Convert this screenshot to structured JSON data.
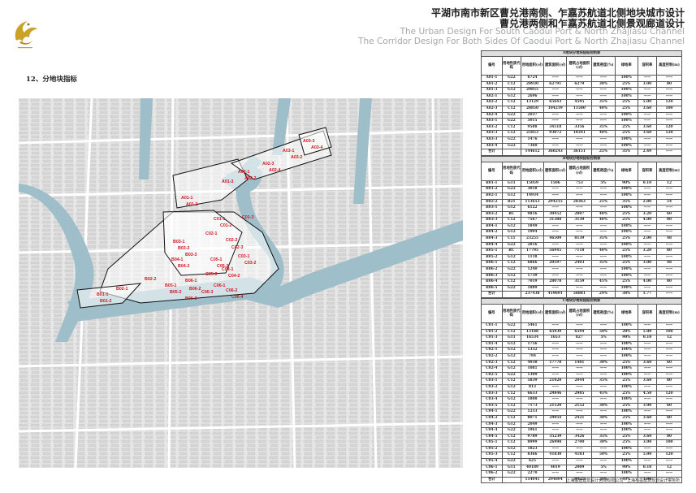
{
  "header": {
    "title_cn_1": "平湖市南市新区曹兑港南侧、乍嘉苏航道北侧地块城市设计",
    "title_cn_2": "曹兑港两侧和乍嘉苏航道北侧景观廊道设计",
    "title_en_1": "The Urban Design For South Caodui Port & North Zhajiasu Channel",
    "title_en_2": "The Corridor Design For Both Sides Of Caodui Port & North Zhajiasu Channel",
    "logo_icon": "phoenix-logo-icon"
  },
  "section": {
    "label": "12、分地块指标"
  },
  "map": {
    "labels": [
      "A03-3",
      "A03-4",
      "A03-1",
      "A03-2",
      "A02-3",
      "A02-4",
      "A02-1",
      "A02-2",
      "A01-3",
      "A01-1",
      "A01-2",
      "C01-1",
      "C01-2",
      "C01-3",
      "C02-1",
      "C02-2",
      "C02-3",
      "C03-1",
      "C03-2",
      "C04-1",
      "C04-2",
      "C05-1",
      "C05-2",
      "C05-3",
      "C06-1",
      "C06-2",
      "C06-3",
      "C06-4",
      "B01-1",
      "B01-2",
      "B02-1",
      "B02-2",
      "B03-1",
      "B03-2",
      "B03-3",
      "B04-1",
      "B04-2",
      "B05-1",
      "B05-2",
      "B06-1",
      "B06-2",
      "B06-3"
    ]
  },
  "tables": [
    {
      "caption": "A地块分地块指标控制表",
      "headers": [
        "编号",
        "用地性质代码",
        "用地面积(㎡)",
        "建筑面积(㎡)",
        "建筑占地面积(㎡)",
        "建筑密度(%)",
        "绿地率",
        "容积率",
        "高度控制(m)"
      ],
      "rows": [
        [
          "A01-1",
          "G22",
          "6724",
          "——",
          "——",
          "——",
          "100%",
          "——",
          "——"
        ],
        [
          "A01-2",
          "C12",
          "20930",
          "62791",
          "6279",
          "30%",
          "25%",
          "3.00",
          "80"
        ],
        [
          "A01-3",
          "G12",
          "20855",
          "——",
          "——",
          "——",
          "100%",
          "——",
          "——"
        ],
        [
          "A02-1",
          "G12",
          "2696",
          "——",
          "——",
          "——",
          "100%",
          "——",
          "——"
        ],
        [
          "A02-2",
          "C12",
          "13129",
          "65643",
          "4595",
          "35%",
          "25%",
          "5.00",
          "120"
        ],
        [
          "A02-3",
          "C12",
          "28850",
          "104219",
          "11580",
          "40%",
          "25%",
          "3.60",
          "100"
        ],
        [
          "A02-4",
          "G22",
          "2037",
          "——",
          "——",
          "——",
          "100%",
          "——",
          "——"
        ],
        [
          "A03-1",
          "G22",
          "5015",
          "——",
          "——",
          "——",
          "100%",
          "——",
          "——"
        ],
        [
          "A03-2",
          "C12",
          "9588",
          "34518",
          "3356",
          "35%",
          "25%",
          "3.60",
          "120"
        ],
        [
          "A03-3",
          "C12",
          "25853",
          "93072",
          "10341",
          "40%",
          "25%",
          "3.60",
          "120"
        ],
        [
          "A03-3",
          "G22",
          "1476",
          "——",
          "——",
          "——",
          "100%",
          "——",
          "——"
        ],
        [
          "A03-4",
          "G22",
          "7360",
          "——",
          "——",
          "——",
          "100%",
          "——",
          "——"
        ]
      ],
      "total": [
        "合计",
        "",
        "144612",
        "360243",
        "36151",
        "25%",
        "35%",
        "2.49",
        "——"
      ]
    },
    {
      "caption": "B地块分地块指标控制表",
      "headers": [
        "编号",
        "用地性质代码",
        "用地面积(㎡)",
        "建筑面积(㎡)",
        "建筑占地面积(㎡)",
        "建筑密度(%)",
        "绿地率",
        "容积率",
        "高度控制(m)"
      ],
      "rows": [
        [
          "B01-1",
          "G11",
          "15059",
          "1506",
          "753",
          "5%",
          "90%",
          "0.10",
          "12"
        ],
        [
          "B01-2",
          "G22",
          "3018",
          "——",
          "——",
          "——",
          "100%",
          "——",
          "——"
        ],
        [
          "B02-1",
          "G12",
          "14934",
          "——",
          "——",
          "——",
          "100%",
          "——",
          "——"
        ],
        [
          "B02-2",
          "R21",
          "113653",
          "294215",
          "28363",
          "25%",
          "35%",
          "2.80",
          "54"
        ],
        [
          "B03-1",
          "G12",
          "6122",
          "——",
          "——",
          "——",
          "100%",
          "——",
          "——"
        ],
        [
          "B03-2",
          "RC",
          "9816",
          "30452",
          "2807",
          "40%",
          "25%",
          "3.20",
          "60"
        ],
        [
          "B03-3",
          "C12",
          "7567",
          "31388",
          "3139",
          "40%",
          "25%",
          "4.00",
          "80"
        ],
        [
          "B04-1",
          "G12",
          "1849",
          "——",
          "——",
          "——",
          "100%",
          "——",
          "——"
        ],
        [
          "B04-2",
          "G12",
          "1904",
          "——",
          "——",
          "——",
          "100%",
          "——",
          "——"
        ],
        [
          "B04-3",
          "C11",
          "23255",
          "46509",
          "8139",
          "35%",
          "25%",
          "2.00",
          "48"
        ],
        [
          "B04-4",
          "G22",
          "2816",
          "——",
          "——",
          "——",
          "100%",
          "——",
          "——"
        ],
        [
          "B05-1",
          "RC",
          "17795",
          "56945",
          "7118",
          "40%",
          "25%",
          "3.20",
          "80"
        ],
        [
          "B05-2",
          "G12",
          "1118",
          "——",
          "——",
          "——",
          "100%",
          "——",
          "——"
        ],
        [
          "B06-1",
          "C12",
          "6866",
          "20597",
          "2403",
          "35%",
          "25%",
          "3.00",
          "48"
        ],
        [
          "B06-2",
          "G22",
          "1240",
          "——",
          "——",
          "——",
          "100%",
          "——",
          "——"
        ],
        [
          "B06-3",
          "G12",
          "1739",
          "——",
          "——",
          "——",
          "100%",
          "——",
          "——"
        ],
        [
          "B06-4",
          "C12",
          "7019",
          "28078",
          "3159",
          "45%",
          "25%",
          "4.00",
          "80"
        ],
        [
          "B06-5",
          "G22",
          "1889",
          "——",
          "——",
          "——",
          "100%",
          "——",
          "——"
        ]
      ],
      "total": [
        "合计",
        "",
        "237438",
        "419691",
        "56881",
        "24%",
        "38%",
        "1.77",
        "——"
      ]
    },
    {
      "caption": "C地块分地块指标控制表",
      "headers": [
        "编号",
        "用地性质代码",
        "用地面积(㎡)",
        "建筑面积(㎡)",
        "建筑占地面积(㎡)",
        "建筑密度(%)",
        "绿地率",
        "容积率",
        "高度控制(m)"
      ],
      "rows": [
        [
          "C01-1",
          "G22",
          "5461",
          "——",
          "——",
          "——",
          "100%",
          "——",
          "——"
        ],
        [
          "C01-2",
          "C12",
          "13188",
          "65939",
          "6594",
          "50%",
          "20%",
          "5.00",
          "100"
        ],
        [
          "C01-3",
          "G11",
          "16534",
          "1653",
          "827",
          "5%",
          "90%",
          "0.10",
          "12"
        ],
        [
          "C01-4",
          "G12",
          "1756",
          "——",
          "——",
          "——",
          "100%",
          "——",
          "——"
        ],
        [
          "C02-1",
          "G12",
          "1332",
          "——",
          "——",
          "——",
          "100%",
          "——",
          "——"
        ],
        [
          "C02-2",
          "G12",
          "784",
          "——",
          "——",
          "——",
          "100%",
          "——",
          "——"
        ],
        [
          "C02-3",
          "C12",
          "4938",
          "17778",
          "1481",
          "30%",
          "25%",
          "3.60",
          "60"
        ],
        [
          "C02-4",
          "G12",
          "1081",
          "——",
          "——",
          "——",
          "100%",
          "——",
          "——"
        ],
        [
          "C02-5",
          "G22",
          "1309",
          "——",
          "——",
          "——",
          "100%",
          "——",
          "——"
        ],
        [
          "C03-1",
          "C12",
          "5839",
          "21020",
          "2044",
          "35%",
          "25%",
          "3.60",
          "80"
        ],
        [
          "C03-2",
          "G12",
          "813",
          "——",
          "——",
          "——",
          "100%",
          "——",
          "——"
        ],
        [
          "C03-3",
          "C12",
          "6633",
          "29846",
          "2985",
          "45%",
          "25%",
          "4.50",
          "120"
        ],
        [
          "C03-4",
          "G12",
          "1808",
          "——",
          "——",
          "——",
          "100%",
          "——",
          "——"
        ],
        [
          "C03-5",
          "C12",
          "7173",
          "21520",
          "2152",
          "30%",
          "25%",
          "3.00",
          "60"
        ],
        [
          "C04-1",
          "G22",
          "1233",
          "——",
          "——",
          "——",
          "100%",
          "——",
          "——"
        ],
        [
          "C04-2",
          "C12",
          "8071",
          "29054",
          "2421",
          "30%",
          "25%",
          "3.60",
          "60"
        ],
        [
          "C04-3",
          "G12",
          "2049",
          "——",
          "——",
          "——",
          "100%",
          "——",
          "——"
        ],
        [
          "C04-4",
          "G22",
          "1961",
          "——",
          "——",
          "——",
          "100%",
          "——",
          "——"
        ],
        [
          "C04-5",
          "C12",
          "9789",
          "35239",
          "3426",
          "35%",
          "25%",
          "3.60",
          "80"
        ],
        [
          "C05-1",
          "C12",
          "8999",
          "26998",
          "2700",
          "30%",
          "25%",
          "3.00",
          "100"
        ],
        [
          "C05-2",
          "G12",
          "1823",
          "——",
          "——",
          "——",
          "100%",
          "——",
          "——"
        ],
        [
          "C05-3",
          "C12",
          "8366",
          "41830",
          "4183",
          "50%",
          "25%",
          "5.00",
          "120"
        ],
        [
          "C05-4",
          "G22",
          "625",
          "——",
          "——",
          "——",
          "100%",
          "——",
          "——"
        ],
        [
          "C06-1",
          "G11",
          "40189",
          "4019",
          "2009",
          "5%",
          "90%",
          "0.10",
          "12"
        ],
        [
          "C06-2",
          "G22",
          "2270",
          "——",
          "——",
          "——",
          "100%",
          "——",
          "——"
        ]
      ],
      "total": [
        "合计",
        "",
        "154041",
        "294894",
        "30622",
        "20%",
        "40%",
        "1.90",
        "——"
      ]
    }
  ],
  "footer": {
    "text": "上海墨远建筑设计咨询有限公司 · 上海朴墨建筑规划设计事务所"
  }
}
